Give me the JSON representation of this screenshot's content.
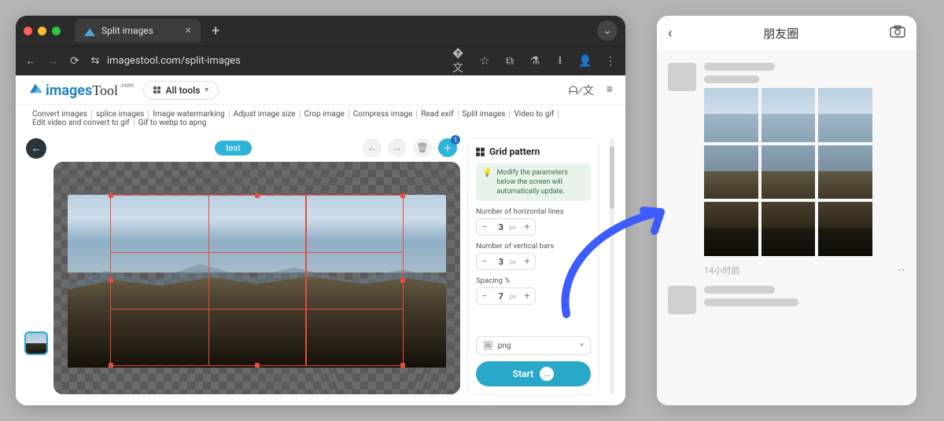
{
  "browser": {
    "tab_title": "Split images",
    "url": "imagestool.com/split-images"
  },
  "app": {
    "logo_a": "images",
    "logo_b": "Tool",
    "logo_dot": ".com",
    "all_tools": "All tools",
    "nav": [
      "Convert images",
      "splice images",
      "Image watermarking",
      "Adjust image size",
      "Crop image",
      "Compress image",
      "Read exif",
      "Split images",
      "Video to gif",
      "Edit video and convert to gif",
      "Gif to webp to apng"
    ],
    "chip": "test",
    "add_badge": "1"
  },
  "panel": {
    "title": "Grid pattern",
    "hint": "Modify the parameters below the screen will automatically update.",
    "field_h": "Number of horizontal lines",
    "val_h": "3",
    "unit_h": "px",
    "field_v": "Number of vertical bars",
    "val_v": "3",
    "unit_v": "px",
    "field_s": "Spacing %",
    "val_s": "7",
    "unit_s": "px",
    "format": "png",
    "start": "Start"
  },
  "phone": {
    "title": "朋友圈",
    "time": "14小时前"
  }
}
